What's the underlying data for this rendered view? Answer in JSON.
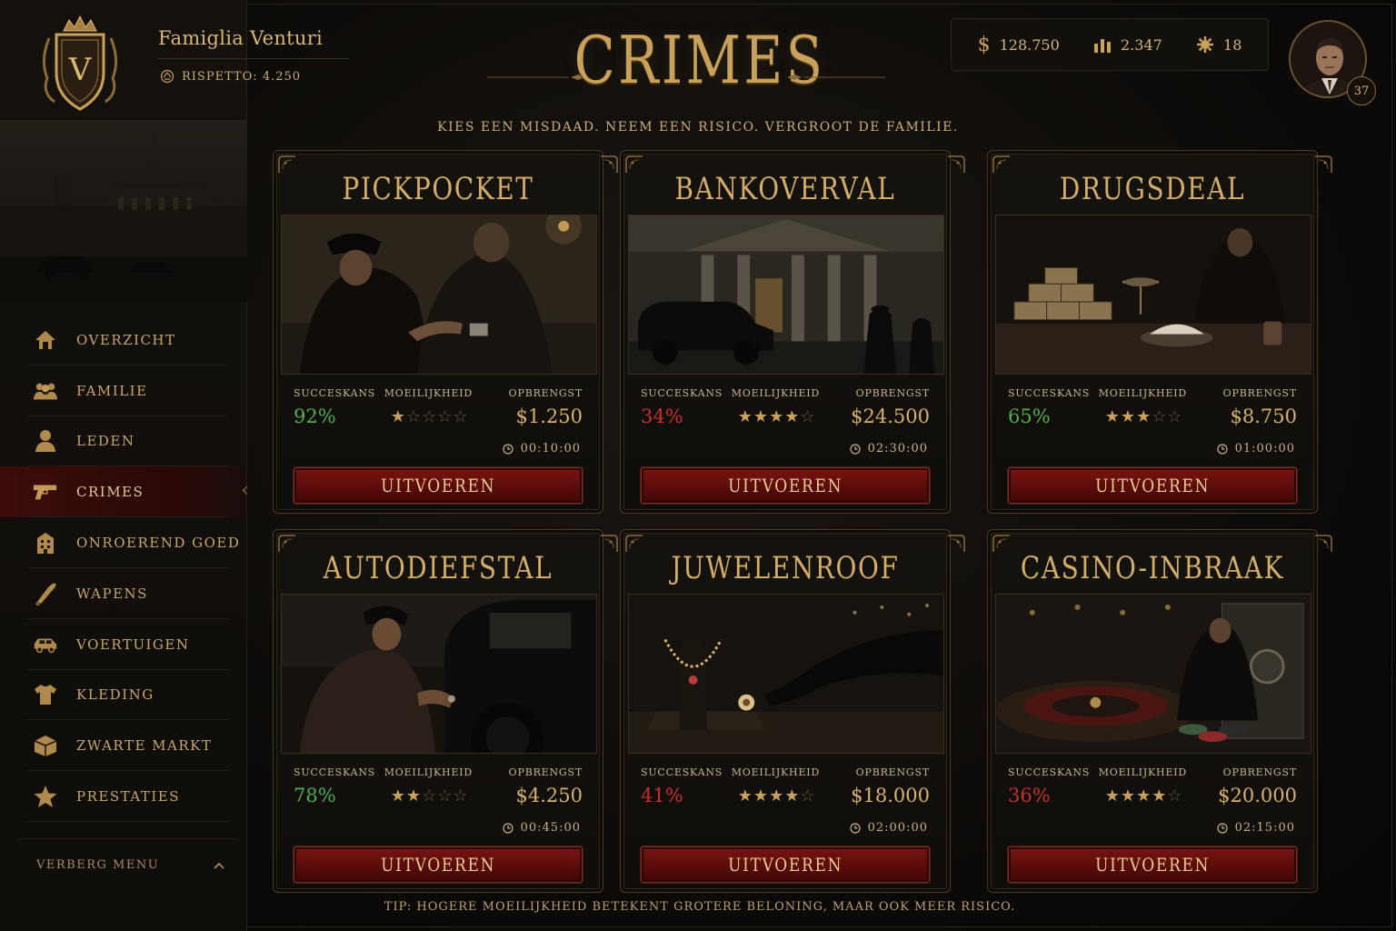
{
  "family": {
    "name": "Famiglia Venturi",
    "respect": "RISPETTO: 4.250",
    "crest_letter": "V"
  },
  "header": {
    "title": "CRIMES",
    "subtitle": "KIES EEN MISDAAD. NEEM EEN RISICO. VERGROOT DE FAMILIE."
  },
  "stats": {
    "money": "128.750",
    "power": "2.347",
    "tokens": "18"
  },
  "player": {
    "level": "37"
  },
  "nav": [
    {
      "label": "OVERZICHT",
      "icon": "home-icon"
    },
    {
      "label": "FAMILIE",
      "icon": "family-icon"
    },
    {
      "label": "LEDEN",
      "icon": "person-icon"
    },
    {
      "label": "CRIMES",
      "icon": "gun-icon",
      "active": true
    },
    {
      "label": "ONROEREND GOED",
      "icon": "building-icon"
    },
    {
      "label": "WAPENS",
      "icon": "bullet-icon"
    },
    {
      "label": "VOERTUIGEN",
      "icon": "car-icon"
    },
    {
      "label": "KLEDING",
      "icon": "shirt-icon"
    },
    {
      "label": "ZWARTE MARKT",
      "icon": "box-icon"
    },
    {
      "label": "PRESTATIES",
      "icon": "star-icon"
    }
  ],
  "hide_menu": "VERBERG MENU",
  "labels": {
    "chance": "SUCCESKANS",
    "difficulty": "MOEILIJKHEID",
    "reward": "OPBRENGST",
    "execute": "UITVOEREN"
  },
  "crimes": [
    {
      "title": "PICKPOCKET",
      "chance": "92%",
      "chance_level": "good",
      "difficulty": 1,
      "reward": "$1.250",
      "time": "00:10:00"
    },
    {
      "title": "BANKOVERVAL",
      "chance": "34%",
      "chance_level": "bad",
      "difficulty": 4,
      "reward": "$24.500",
      "time": "02:30:00"
    },
    {
      "title": "DRUGSDEAL",
      "chance": "65%",
      "chance_level": "good",
      "difficulty": 3,
      "reward": "$8.750",
      "time": "01:00:00"
    },
    {
      "title": "AUTODIEFSTAL",
      "chance": "78%",
      "chance_level": "good",
      "difficulty": 2,
      "reward": "$4.250",
      "time": "00:45:00"
    },
    {
      "title": "JUWELENROOF",
      "chance": "41%",
      "chance_level": "bad",
      "difficulty": 4,
      "reward": "$18.000",
      "time": "02:00:00"
    },
    {
      "title": "CASINO-INBRAAK",
      "chance": "36%",
      "chance_level": "bad",
      "difficulty": 4,
      "reward": "$20.000",
      "time": "02:15:00"
    }
  ],
  "tip": "TIP: HOGERE MOEILIJKHEID BETEKENT GROTERE BELONING, MAAR OOK MEER RISICO.",
  "colors": {
    "gold": "#c9a15a",
    "good": "#4fae4c",
    "bad": "#c8302a",
    "button": "#6a0f0c"
  }
}
